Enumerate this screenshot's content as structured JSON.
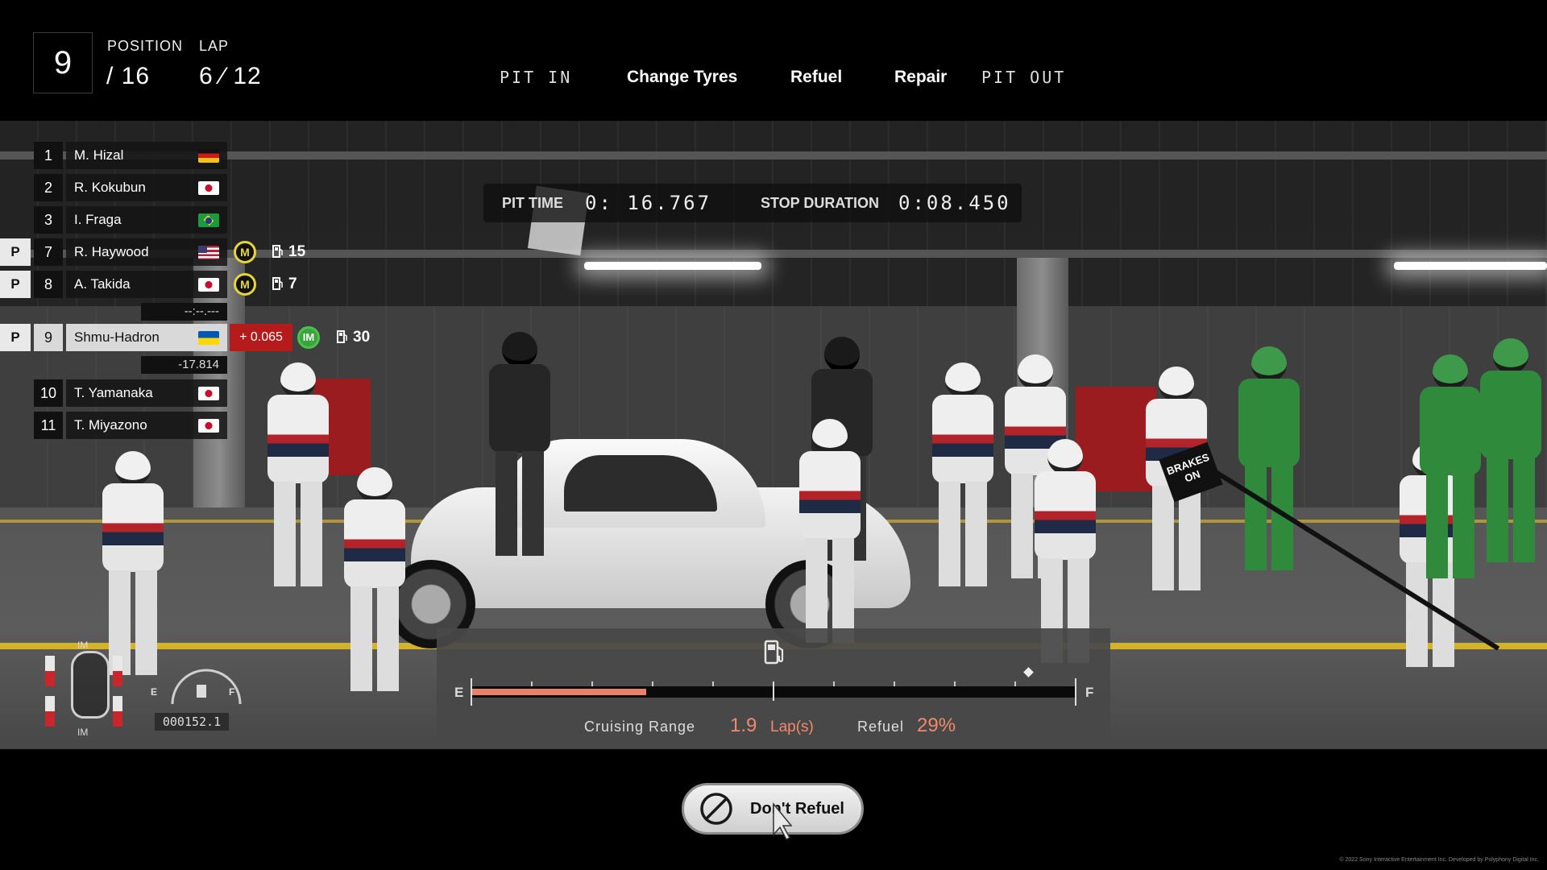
{
  "hud": {
    "position_value": "9",
    "position_label": "POSITION",
    "position_total": "/ 16",
    "lap_label": "LAP",
    "lap_value": "6 ⁄ 12"
  },
  "pit_steps": {
    "pit_in": "PIT IN",
    "change_tyres": "Change Tyres",
    "refuel": "Refuel",
    "repair": "Repair",
    "pit_out": "PIT OUT"
  },
  "pit_timer": {
    "pit_time_label": "PIT TIME",
    "pit_time_value": "0: 16.767",
    "stop_duration_label": "STOP DURATION",
    "stop_duration_value": "0:08.450"
  },
  "standings": {
    "rows": [
      {
        "pos": "1",
        "name": "M. Hizal",
        "flag": "germany-flag"
      },
      {
        "pos": "2",
        "name": "R. Kokubun",
        "flag": "japan-flag"
      },
      {
        "pos": "3",
        "name": "I. Fraga",
        "flag": "brazil-flag"
      },
      {
        "pit": "P",
        "pos": "7",
        "name": "R. Haywood",
        "flag": "usa-flag",
        "tyre": "M",
        "fuel": "15"
      },
      {
        "pit": "P",
        "pos": "8",
        "name": "A. Takida",
        "flag": "japan-flag",
        "tyre": "M",
        "fuel": "7"
      },
      {
        "gap": "--:--.---"
      },
      {
        "pit": "P",
        "pos": "9",
        "name": "Shmu-Hadron",
        "flag": "ukraine-flag",
        "delta": "+ 0.065",
        "tyre": "IM",
        "fuel": "30",
        "player": true
      },
      {
        "gap": "-17.814"
      },
      {
        "pos": "10",
        "name": "T. Yamanaka",
        "flag": "japan-flag"
      },
      {
        "pos": "11",
        "name": "T. Miyazono",
        "flag": "japan-flag"
      }
    ]
  },
  "car_status": {
    "tyre_front": "IM",
    "tyre_rear": "IM",
    "gauge_e": "E",
    "gauge_f": "F",
    "odometer": "000152.1"
  },
  "scene": {
    "sign_text": "BRAKES ON"
  },
  "refuel_panel": {
    "icon": "fuel-pump-icon",
    "empty_label": "E",
    "full_label": "F",
    "current_fuel_fraction": 0.29,
    "target_marker_fraction": 0.92,
    "cruising_range_label": "Cruising Range",
    "cruising_range_value": "1.9",
    "cruising_range_unit": "Lap(s)",
    "refuel_label": "Refuel",
    "refuel_value": "29%"
  },
  "action": {
    "dont_refuel_label": "Don't Refuel",
    "icon": "prohibited-icon"
  },
  "footer": {
    "copyright": "© 2022 Sony Interactive Entertainment Inc. Developed by Polyphony Digital Inc."
  },
  "colors": {
    "accent_orange": "#f08a6c",
    "delta_red": "#b51b1b",
    "medium_tyre": "#e6d63a",
    "intermediate_tyre": "#3aa33a"
  }
}
